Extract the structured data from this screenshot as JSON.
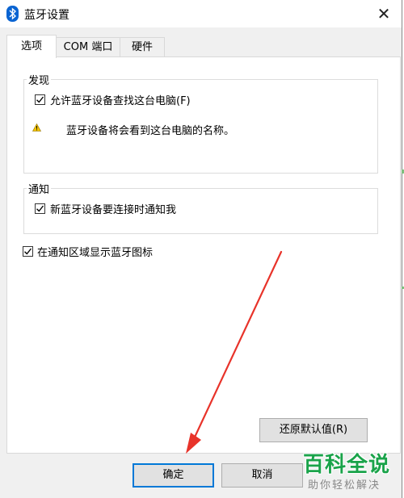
{
  "window": {
    "title": "蓝牙设置",
    "title_icon": "bluetooth-icon",
    "close_icon": "close-icon"
  },
  "tabs": [
    {
      "label": "选项",
      "active": true
    },
    {
      "label": "COM 端口",
      "active": false
    },
    {
      "label": "硬件",
      "active": false
    }
  ],
  "discovery": {
    "group_label": "发现",
    "allow_discovery": {
      "label": "允许蓝牙设备查找这台电脑(F)",
      "checked": true
    },
    "warning_icon": "warning-icon",
    "warning_text": "蓝牙设备将会看到这台电脑的名称。"
  },
  "notifications": {
    "group_label": "通知",
    "notify_new_device": {
      "label": "新蓝牙设备要连接时通知我",
      "checked": true
    }
  },
  "show_tray_icon": {
    "label": "在通知区域显示蓝牙图标",
    "checked": true
  },
  "buttons": {
    "restore_defaults": "还原默认值(R)",
    "ok": "确定",
    "cancel": "取消"
  },
  "watermark": {
    "main": "百科全说",
    "sub": "助你轻松解决"
  },
  "colors": {
    "accent": "#0078d7",
    "arrow": "#e8332a",
    "watermark": "#1aa34a"
  }
}
